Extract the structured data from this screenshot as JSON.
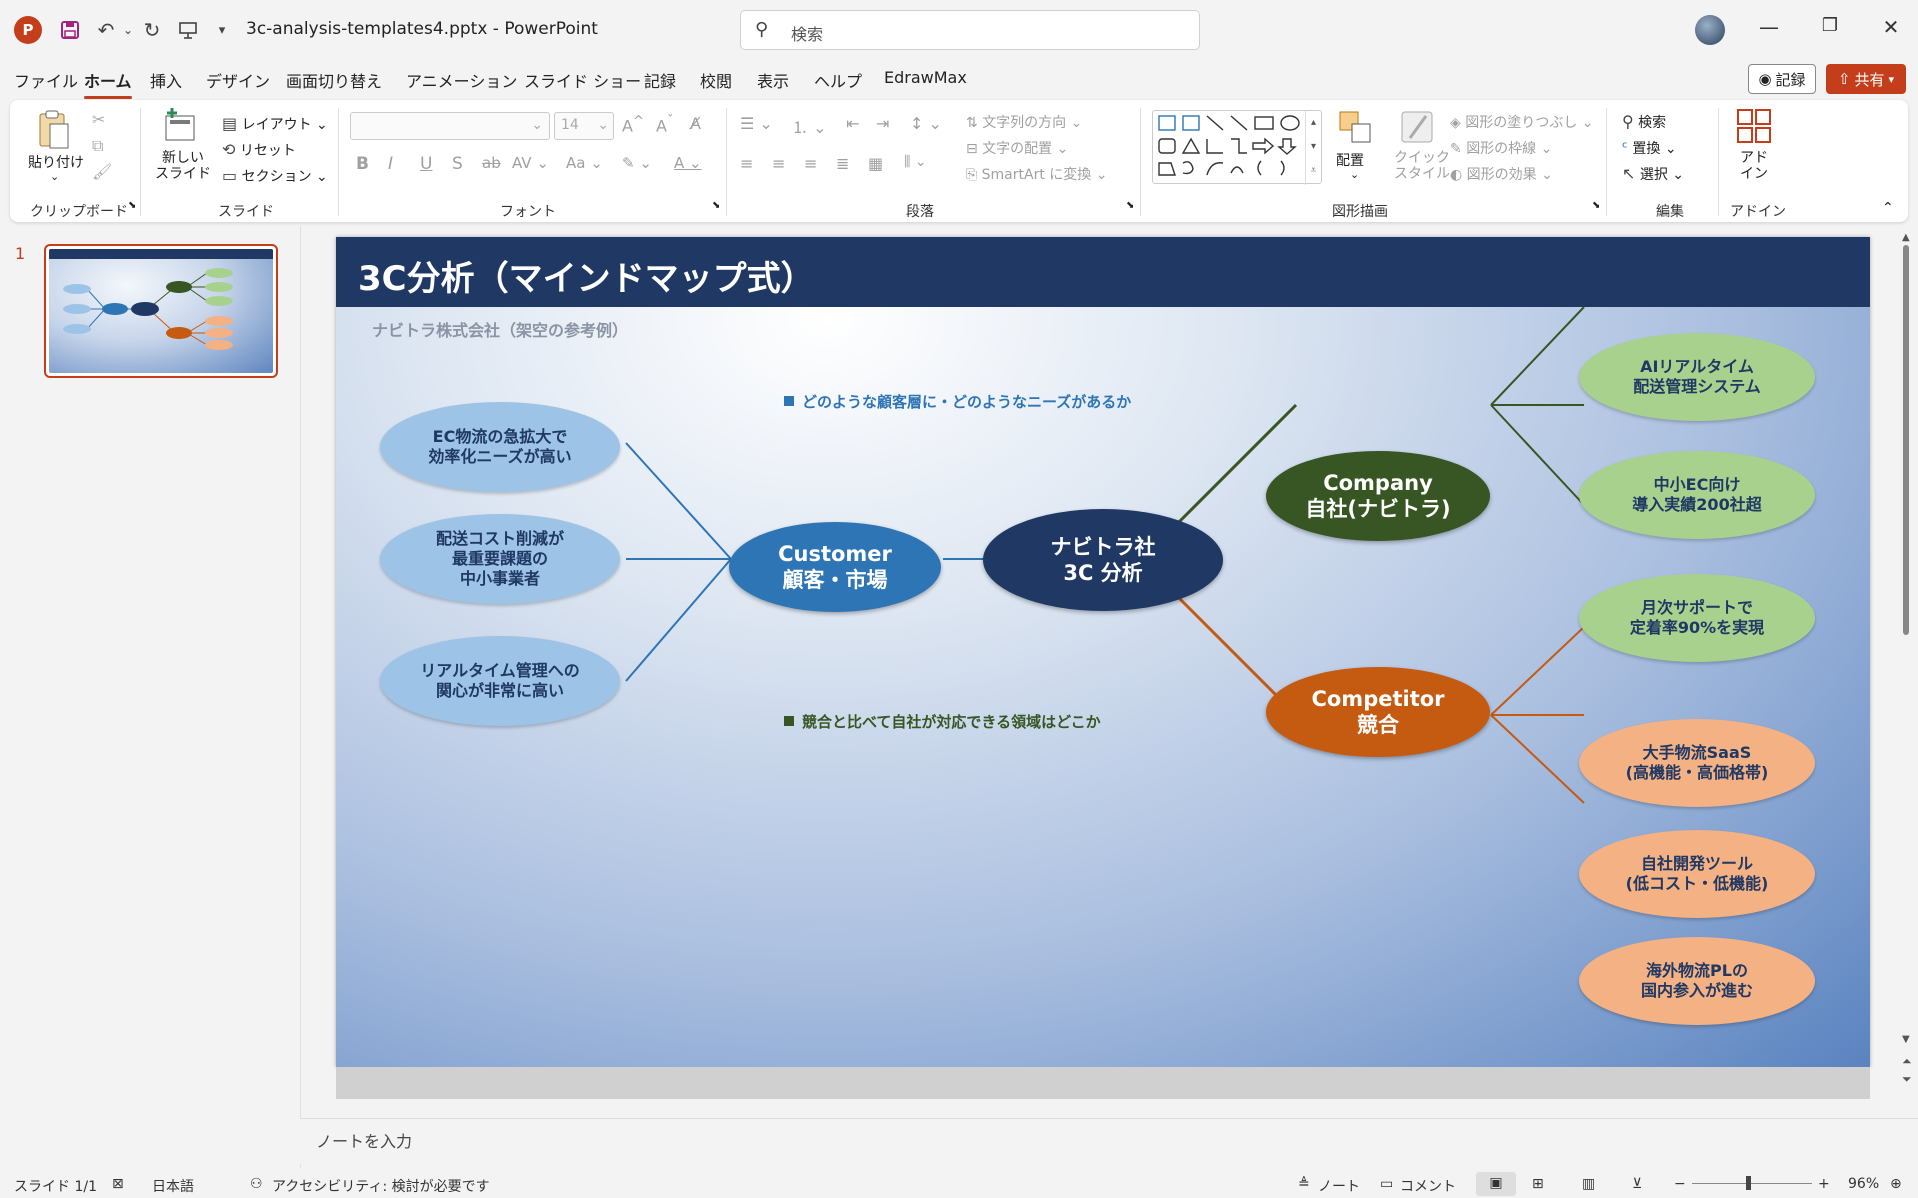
{
  "titlebar": {
    "app_letter": "P",
    "doc_title": "3c-analysis-templates4.pptx  -  PowerPoint",
    "search_placeholder": "検索",
    "minimize": "—",
    "restore": "❐",
    "close": "✕"
  },
  "menu": {
    "tabs": [
      "ファイル",
      "ホーム",
      "挿入",
      "デザイン",
      "画面切り替え",
      "アニメーション",
      "スライド ショー",
      "記録",
      "校閲",
      "表示",
      "ヘルプ",
      "EdrawMax"
    ],
    "active": "ホーム",
    "record": "記録",
    "share": "共有"
  },
  "ribbon": {
    "clipboard": {
      "paste": "貼り付け",
      "label": "クリップボード"
    },
    "slides": {
      "new_slide": "新しい\nスライド",
      "layout": "レイアウト",
      "reset": "リセット",
      "section": "セクション",
      "label": "スライド"
    },
    "font": {
      "size": "14",
      "label": "フォント"
    },
    "paragraph": {
      "text_direction": "文字列の方向",
      "align_text": "文字の配置",
      "smartart": "SmartArt に変換",
      "label": "段落"
    },
    "drawing": {
      "arrange": "配置",
      "quick_style": "クイック\nスタイル",
      "fill": "図形の塗りつぶし",
      "outline": "図形の枠線",
      "effects": "図形の効果",
      "label": "図形描画"
    },
    "editing": {
      "find": "検索",
      "replace": "置換",
      "select": "選択",
      "label": "編集"
    },
    "addin": {
      "addin": "アド\nイン",
      "label": "アドイン"
    }
  },
  "thumbnails": {
    "slide_number": "1"
  },
  "slide": {
    "title": "3C分析（マインドマップ式）",
    "subtitle": "ナビトラ株式会社（架空の参考例）",
    "center": "ナビトラ社\n3C 分析",
    "customer": "Customer\n顧客・市場",
    "company": "Company\n自社(ナビトラ)",
    "competitor": "Competitor\n競合",
    "customer_leaves": [
      "EC物流の急拡大で\n効率化ニーズが高い",
      "配送コスト削減が\n最重要課題の\n中小事業者",
      "リアルタイム管理への\n関心が非常に高い"
    ],
    "company_leaves": [
      "AIリアルタイム\n配送管理システム",
      "中小EC向け\n導入実績200社超",
      "月次サポートで\n定着率90%を実現"
    ],
    "competitor_leaves": [
      "大手物流SaaS\n(高機能・高価格帯)",
      "自社開発ツール\n(低コスト・低機能)",
      "海外物流PLの\n国内参入が進む"
    ],
    "note_top": "どのような顧客層に・どのようなニーズがあるか",
    "note_bottom": "競合と比べて自社が対応できる領域はどこか",
    "colors": {
      "customer": "#2e75b6",
      "company": "#375623",
      "competitor": "#c55a11",
      "center": "#1f3864",
      "note_top": "#2e75b6",
      "note_bottom": "#375623"
    }
  },
  "notes": {
    "placeholder": "ノートを入力"
  },
  "status": {
    "slide": "スライド 1/1",
    "language": "日本語",
    "accessibility": "アクセシビリティ: 検討が必要です",
    "notes": "ノート",
    "comments": "コメント",
    "zoom": "96%"
  }
}
